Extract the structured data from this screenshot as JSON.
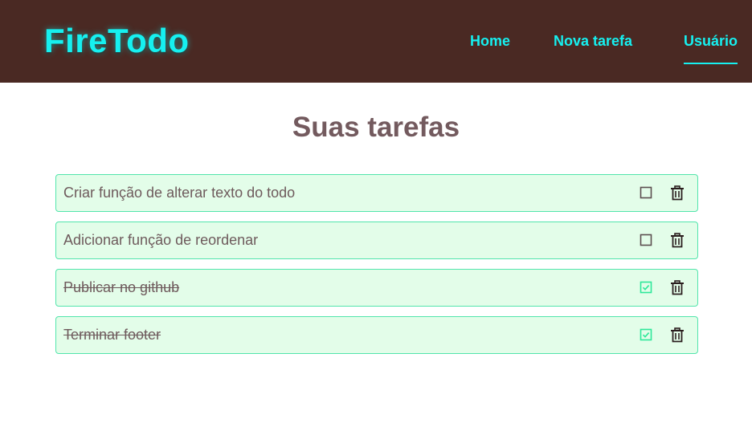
{
  "header": {
    "logo": "FireTodo",
    "nav": {
      "home": "Home",
      "new_task": "Nova tarefa",
      "user": "Usuário"
    },
    "colors": {
      "background": "#4a2923",
      "accent": "#16f0f0"
    }
  },
  "main": {
    "title": "Suas tarefas",
    "todos": [
      {
        "text": "Criar função de alterar texto do todo",
        "done": false
      },
      {
        "text": "Adicionar função de reordenar",
        "done": false
      },
      {
        "text": "Publicar no github",
        "done": true
      },
      {
        "text": "Terminar footer",
        "done": true
      }
    ],
    "icons": {
      "unchecked": "square-icon",
      "checked": "check-square-icon",
      "delete": "trash-icon"
    },
    "colors": {
      "item_background": "#e3fde9",
      "item_border": "#52e5ac",
      "checked_icon": "#2ee89a"
    }
  }
}
